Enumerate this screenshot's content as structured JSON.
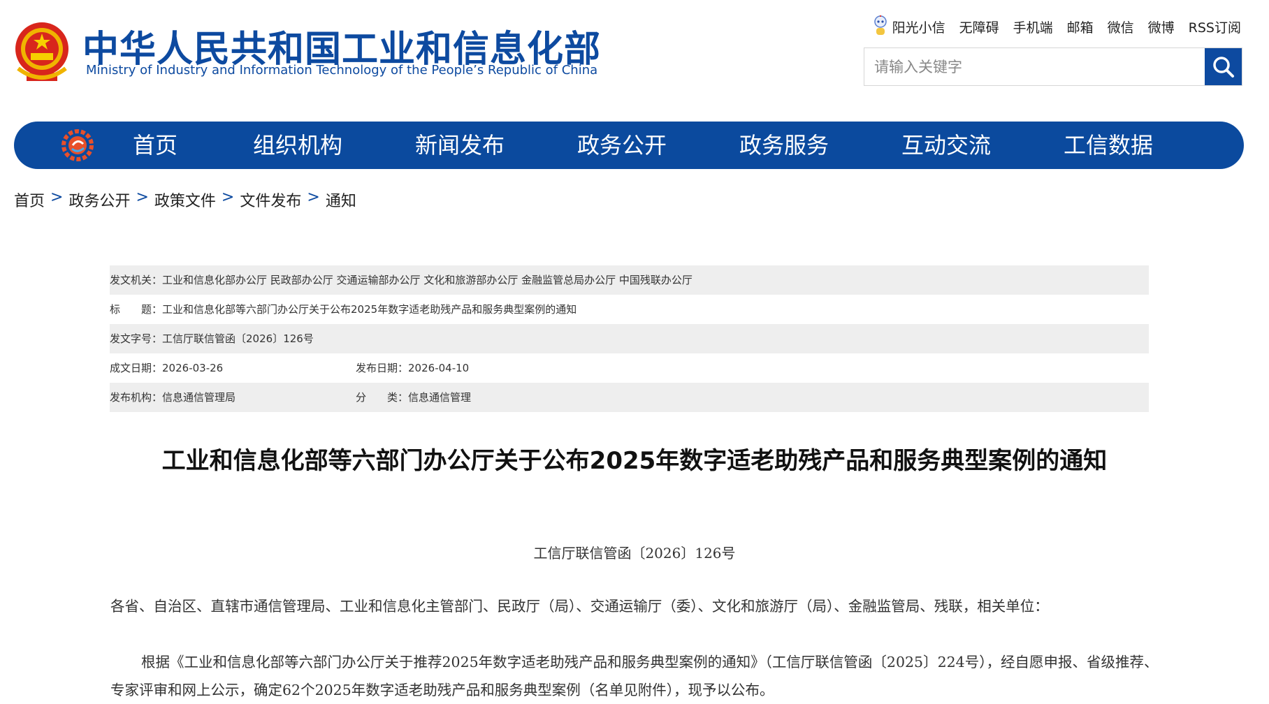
{
  "header": {
    "title_cn": "中华人民共和国工业和信息化部",
    "title_en": "Ministry of Industry and Information Technology of the People’s Republic of China",
    "top_links": [
      "阳光小信",
      "无障碍",
      "手机端",
      "邮箱",
      "微信",
      "微博",
      "RSS订阅"
    ],
    "search_placeholder": "请输入关键字"
  },
  "nav": {
    "items": [
      "首页",
      "组织机构",
      "新闻发布",
      "政务公开",
      "政务服务",
      "互动交流",
      "工信数据"
    ]
  },
  "breadcrumb": [
    "首页",
    "政务公开",
    "政策文件",
    "文件发布",
    "通知"
  ],
  "breadcrumb_sep": ">",
  "info": {
    "issuer_label": "发文机关：",
    "issuer_value": "工业和信息化部办公厅 民政部办公厅 交通运输部办公厅 文化和旅游部办公厅 金融监管总局办公厅 中国残联办公厅",
    "title_label": "标　　题：",
    "title_value": "工业和信息化部等六部门办公厅关于公布2025年数字适老助残产品和服务典型案例的通知",
    "docno_label": "发文字号：",
    "docno_value": "工信厅联信管函〔2026〕126号",
    "created_label": "成文日期：",
    "created_value": "2026-03-26",
    "published_label": "发布日期：",
    "published_value": "2026-04-10",
    "org_label": "发布机构：",
    "org_value": "信息通信管理局",
    "category_label": "分　　类：",
    "category_value": "信息通信管理"
  },
  "article": {
    "title": "工业和信息化部等六部门办公厅关于公布2025年数字适老助残产品和服务典型案例的通知",
    "doc_number": "工信厅联信管函〔2026〕126号",
    "salutation": "各省、自治区、直辖市通信管理局、工业和信息化主管部门、民政厅（局）、交通运输厅（委）、文化和旅游厅（局）、金融监管局、残联，相关单位：",
    "paragraph_1": "根据《工业和信息化部等六部门办公厅关于推荐2025年数字适老助残产品和服务典型案例的通知》（工信厅联信管函〔2025〕224号），经自愿申报、省级推荐、专家评审和网上公示，确定62个2025年数字适老助残产品和服务典型案例（名单见附件），现予以公布。"
  },
  "colors": {
    "brand_blue": "#0b4a9e",
    "row_shade": "#eeeeee"
  },
  "icons": {
    "emblem": "national-emblem-icon",
    "robot": "robot-assistant-icon",
    "search": "search-icon",
    "nav_logo": "ministry-gear-logo-icon"
  }
}
